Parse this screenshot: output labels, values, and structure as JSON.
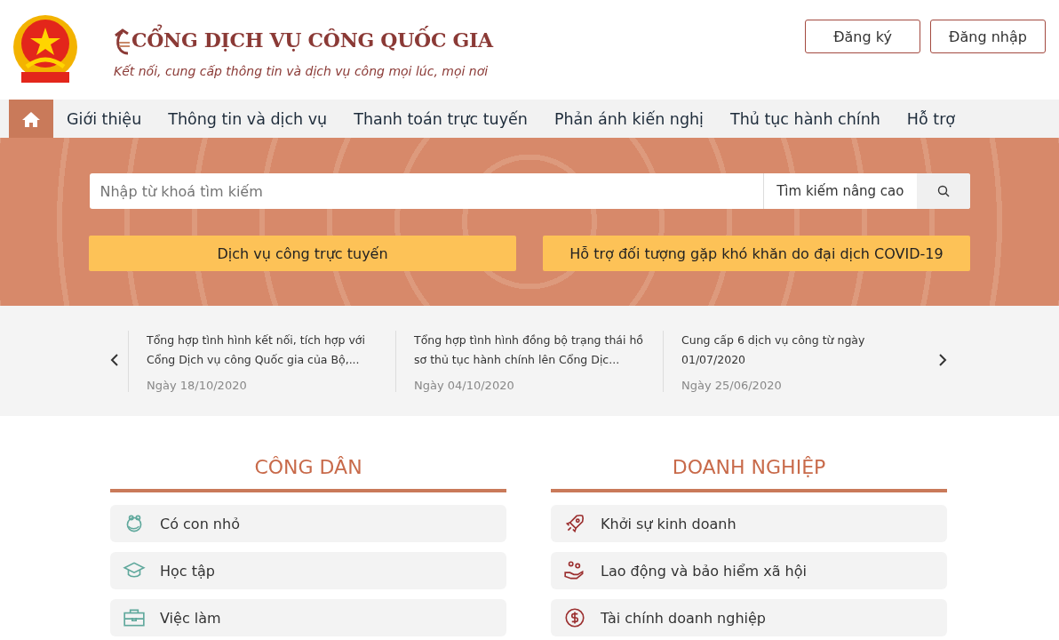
{
  "header": {
    "title": "CỔNG DỊCH VỤ CÔNG QUỐC GIA",
    "tagline": "Kết nối, cung cấp thông tin và dịch vụ công mọi lúc, mọi nơi",
    "buttons": [
      "Đăng ký",
      "Đăng nhập"
    ]
  },
  "nav": {
    "home": {
      "selected": true
    },
    "items": [
      {
        "label": "Giới thiệu",
        "selected": false
      },
      {
        "label": "Thông tin và dịch vụ",
        "selected": false
      },
      {
        "label": "Thanh toán trực tuyến",
        "selected": false
      },
      {
        "label": "Phản ánh kiến nghị",
        "selected": false
      },
      {
        "label": "Thủ tục hành chính",
        "selected": false
      },
      {
        "label": "Hỗ trợ",
        "selected": false
      }
    ]
  },
  "search": {
    "placeholder": "Nhập từ khoá tìm kiếm",
    "advanced": "Tìm kiếm nâng cao"
  },
  "quick_buttons": [
    "Dịch vụ công trực tuyến",
    "Hỗ trợ đối tượng gặp khó khăn do đại dịch COVID-19"
  ],
  "news": [
    {
      "title": "Tổng hợp tình hình kết nối, tích hợp với Cổng Dịch vụ công Quốc gia của Bộ,...",
      "date": "Ngày 18/10/2020"
    },
    {
      "title": "Tổng hợp tình hình đồng bộ trạng thái hồ sơ thủ tục hành chính lên Cổng Dịc...",
      "date": "Ngày 04/10/2020"
    },
    {
      "title": "Cung cấp 6 dịch vụ công từ ngày 01/07/2020",
      "date": "Ngày 25/06/2020"
    }
  ],
  "sections": [
    {
      "title": "CÔNG DÂN",
      "items": [
        "Có con nhỏ",
        "Học tập",
        "Việc làm"
      ]
    },
    {
      "title": "DOANH NGHIỆP",
      "items": [
        "Khởi sự kinh doanh",
        "Lao động và bảo hiểm xã hội",
        "Tài chính doanh nghiệp"
      ]
    }
  ]
}
